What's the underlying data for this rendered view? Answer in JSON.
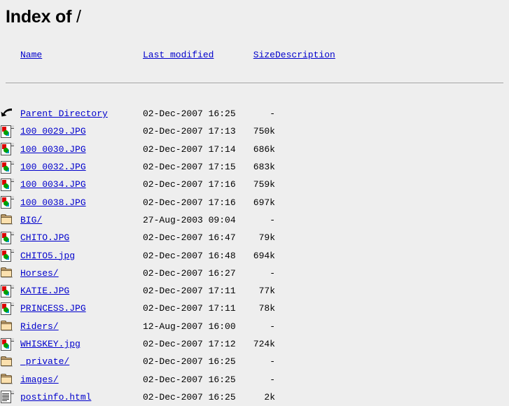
{
  "page": {
    "heading_prefix": "Index of ",
    "path": "/"
  },
  "table": {
    "headers": {
      "name": "Name",
      "last_modified": "Last modified",
      "size": "Size",
      "description": "Description"
    },
    "rows": [
      {
        "icon": "back-arrow-icon",
        "name": "Parent Directory",
        "last_modified": "02-Dec-2007 16:25",
        "size": "-",
        "description": ""
      },
      {
        "icon": "image-file-icon",
        "name": "100_0029.JPG",
        "last_modified": "02-Dec-2007 17:13",
        "size": "750k",
        "description": ""
      },
      {
        "icon": "image-file-icon",
        "name": "100_0030.JPG",
        "last_modified": "02-Dec-2007 17:14",
        "size": "686k",
        "description": ""
      },
      {
        "icon": "image-file-icon",
        "name": "100_0032.JPG",
        "last_modified": "02-Dec-2007 17:15",
        "size": "683k",
        "description": ""
      },
      {
        "icon": "image-file-icon",
        "name": "100_0034.JPG",
        "last_modified": "02-Dec-2007 17:16",
        "size": "759k",
        "description": ""
      },
      {
        "icon": "image-file-icon",
        "name": "100_0038.JPG",
        "last_modified": "02-Dec-2007 17:16",
        "size": "697k",
        "description": ""
      },
      {
        "icon": "folder-icon",
        "name": "BIG/",
        "last_modified": "27-Aug-2003 09:04",
        "size": "-",
        "description": ""
      },
      {
        "icon": "image-file-icon",
        "name": "CHITO.JPG",
        "last_modified": "02-Dec-2007 16:47",
        "size": "79k",
        "description": ""
      },
      {
        "icon": "image-file-icon",
        "name": "CHITO5.jpg",
        "last_modified": "02-Dec-2007 16:48",
        "size": "694k",
        "description": ""
      },
      {
        "icon": "folder-icon",
        "name": "Horses/",
        "last_modified": "02-Dec-2007 16:27",
        "size": "-",
        "description": ""
      },
      {
        "icon": "image-file-icon",
        "name": "KATIE.JPG",
        "last_modified": "02-Dec-2007 17:11",
        "size": "77k",
        "description": ""
      },
      {
        "icon": "image-file-icon",
        "name": "PRINCESS.JPG",
        "last_modified": "02-Dec-2007 17:11",
        "size": "78k",
        "description": ""
      },
      {
        "icon": "folder-icon",
        "name": "Riders/",
        "last_modified": "12-Aug-2007 16:00",
        "size": "-",
        "description": ""
      },
      {
        "icon": "image-file-icon",
        "name": "WHISKEY.jpg",
        "last_modified": "02-Dec-2007 17:12",
        "size": "724k",
        "description": ""
      },
      {
        "icon": "folder-icon",
        "name": "_private/",
        "last_modified": "02-Dec-2007 16:25",
        "size": "-",
        "description": ""
      },
      {
        "icon": "folder-icon",
        "name": "images/",
        "last_modified": "02-Dec-2007 16:25",
        "size": "-",
        "description": ""
      },
      {
        "icon": "text-file-icon",
        "name": "postinfo.html",
        "last_modified": "02-Dec-2007 16:25",
        "size": "2k",
        "description": ""
      }
    ]
  },
  "colors": {
    "background": "#eeeeee",
    "link": "#0000cc",
    "text": "#000000",
    "rule": "#a0a0a0"
  }
}
